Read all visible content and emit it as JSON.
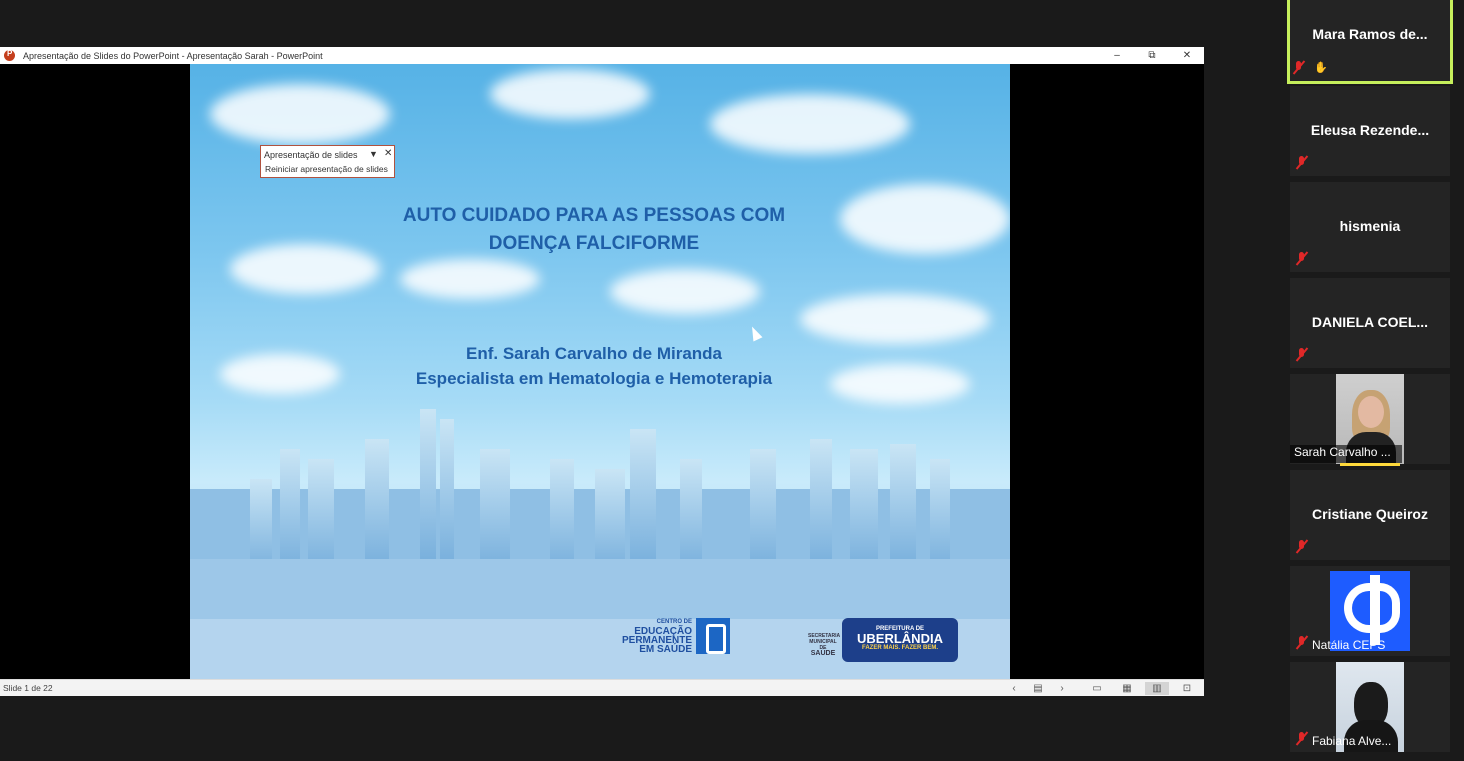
{
  "powerpoint": {
    "window_title": "Apresentação de Slides do PowerPoint  -  Apresentação Sarah  -  PowerPoint",
    "minimize": "–",
    "restore": "⧉",
    "close": "✕",
    "status": {
      "slide_counter": "Slide 1 de 22"
    }
  },
  "slide": {
    "title_line1": "AUTO CUIDADO PARA AS PESSOAS COM",
    "title_line2": "DOENÇA FALCIFORME",
    "author_line1": "Enf. Sarah Carvalho de Miranda",
    "author_line2": "Especialista em Hematologia e Hemoterapia",
    "ceps_logo": {
      "line1": "CENTRO DE",
      "line2": "EDUCAÇÃO",
      "line3": "PERMANENTE",
      "line4": "EM SAÚDE"
    },
    "secretaria_logo": {
      "line1": "SECRETARIA",
      "line2": "MUNICIPAL DE",
      "line3": "SAÚDE"
    },
    "prefeitura_logo": {
      "line1": "PREFEITURA DE",
      "line2": "UBERLÂNDIA",
      "line3": "FAZER MAIS. FAZER BEM."
    }
  },
  "slideshow_popup": {
    "selected": "Apresentação de slides",
    "option": "Reiniciar apresentação de slides"
  },
  "participants": [
    {
      "name": "Mara Ramos de...",
      "muted": true,
      "hand_raised": true,
      "active_speaker": true
    },
    {
      "name": "Eleusa Rezende...",
      "muted": true
    },
    {
      "name": "hismenia",
      "muted": true
    },
    {
      "name": "DANIELA COEL...",
      "muted": true
    },
    {
      "name": "Sarah Carvalho ...",
      "muted": false,
      "video": true
    },
    {
      "name": "Cristiane Queiroz",
      "muted": true
    },
    {
      "name": "Natália CEPS",
      "muted": true,
      "avatar": "ceps-logo"
    },
    {
      "name": "Fabiana Alve...",
      "muted": true,
      "video": true
    }
  ],
  "colors": {
    "active_speaker_border": "#c6ef5c",
    "mute_red": "#e02828",
    "title_blue": "#1f5fa8"
  }
}
